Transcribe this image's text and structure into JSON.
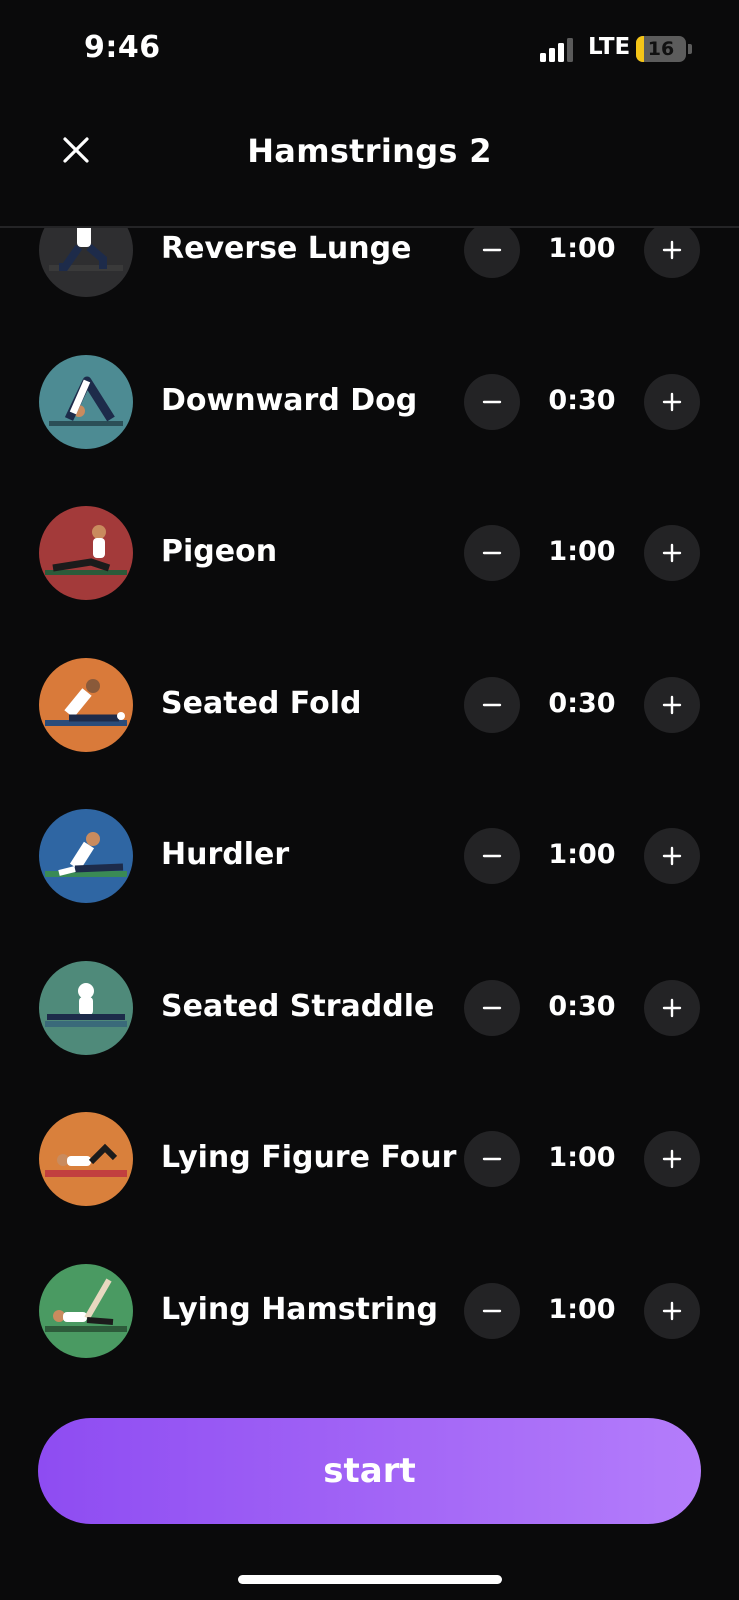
{
  "status": {
    "time": "9:46",
    "network": "LTE",
    "battery": "16",
    "battery_level": 0.16
  },
  "header": {
    "title": "Hamstrings 2",
    "close_icon": "close-icon"
  },
  "exercises": [
    {
      "name": "Reverse Lunge",
      "duration": "1:00",
      "bg": "#2e2e30"
    },
    {
      "name": "Downward Dog",
      "duration": "0:30",
      "bg": "#4d8b93"
    },
    {
      "name": "Pigeon",
      "duration": "1:00",
      "bg": "#a33a3a"
    },
    {
      "name": "Seated Fold",
      "duration": "0:30",
      "bg": "#d97a3a"
    },
    {
      "name": "Hurdler",
      "duration": "1:00",
      "bg": "#2f66a3"
    },
    {
      "name": "Seated Straddle",
      "duration": "0:30",
      "bg": "#4f8a7a"
    },
    {
      "name": "Lying Figure Four",
      "duration": "1:00",
      "bg": "#d9803c"
    },
    {
      "name": "Lying Hamstring",
      "duration": "1:00",
      "bg": "#4a9a62"
    }
  ],
  "controls": {
    "decrease_icon": "minus-icon",
    "increase_icon": "plus-icon"
  },
  "start_button": {
    "label": "start"
  }
}
